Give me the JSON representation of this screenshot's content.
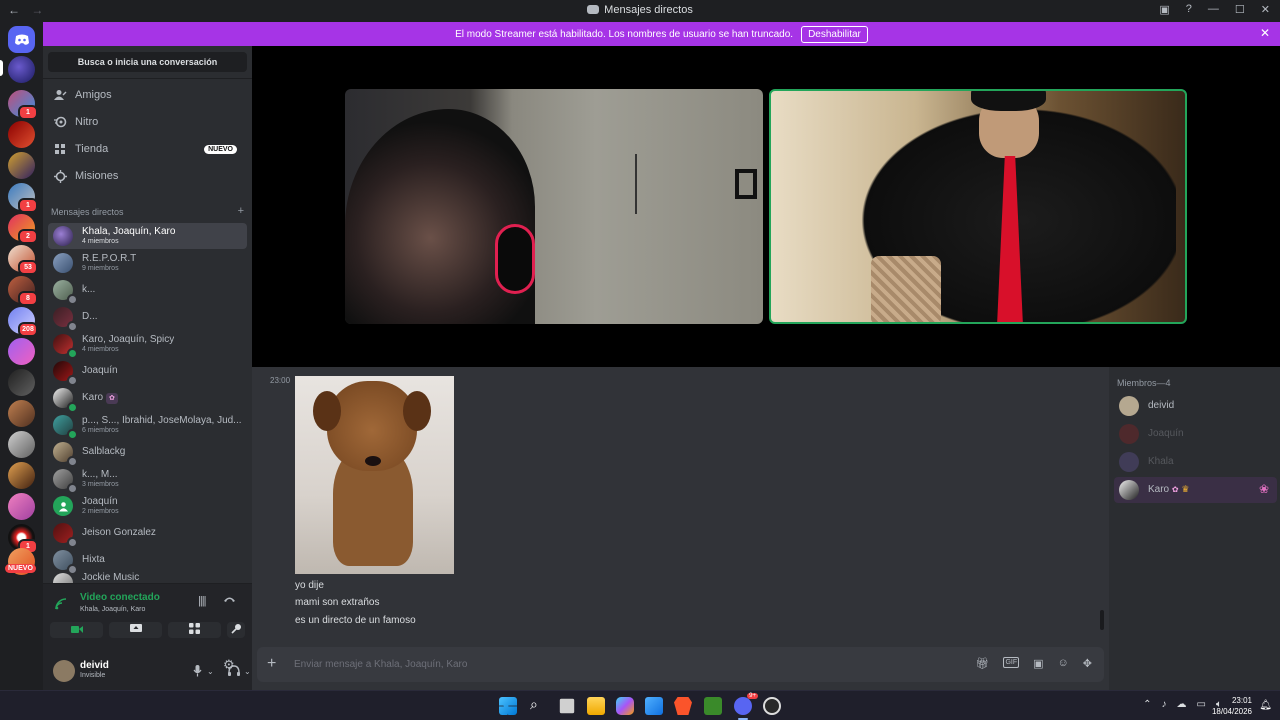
{
  "window": {
    "back": "←",
    "forward": "→",
    "title": "Mensajes directos"
  },
  "banner": {
    "text": "El modo Streamer está habilitado. Los nombres de usuario se han truncado.",
    "button": "Deshabilitar",
    "close": "✕"
  },
  "rail": {
    "badges": [
      "1",
      "2",
      "53",
      "8",
      "208",
      "1"
    ],
    "new_label": "NUEVO"
  },
  "sidebar": {
    "search_placeholder": "Busca o inicia una conversación",
    "nav": [
      {
        "label": "Amigos",
        "icon": "friends-icon"
      },
      {
        "label": "Nitro",
        "icon": "nitro-icon"
      },
      {
        "label": "Tienda",
        "icon": "shop-icon",
        "badge": "NUEVO"
      },
      {
        "label": "Misiones",
        "icon": "quests-icon"
      }
    ],
    "dm_header": "Mensajes directos",
    "dm_add": "+",
    "dms": [
      {
        "name": "Khala, Joaquín, Karo",
        "sub": "4 miembros"
      },
      {
        "name": "R.E.P.O.R.T",
        "sub": "9 miembros"
      },
      {
        "name": "k..."
      },
      {
        "name": "D..."
      },
      {
        "name": "Karo, Joaquín, Spicy",
        "sub": "4 miembros"
      },
      {
        "name": "Joaquín"
      },
      {
        "name": "Karo"
      },
      {
        "name": "p..., S..., Ibrahid, JoseMolaya, Jud...",
        "sub": "6 miembros"
      },
      {
        "name": "Salblackg"
      },
      {
        "name": "k..., M...",
        "sub": "3 miembros"
      },
      {
        "name": "Joaquín",
        "sub": "2 miembros"
      },
      {
        "name": "Jeison Gonzalez"
      },
      {
        "name": "Hixta"
      },
      {
        "name": "Jockie Music"
      }
    ]
  },
  "voice": {
    "status": "Video conectado",
    "channel": "Khala, Joaquín, Karo"
  },
  "user": {
    "name": "deivid",
    "status": "Invisible"
  },
  "chat": {
    "timestamp": "23:00",
    "messages": [
      "yo dije",
      "mami son extraños",
      "es un directo de un famoso"
    ],
    "composer_placeholder": "Enviar mensaje a Khala, Joaquín, Karo"
  },
  "members": {
    "header": "Miembros—4",
    "list": [
      "deivid",
      "Joaquín",
      "Khala",
      "Karo"
    ]
  },
  "taskbar": {
    "time": "23:01",
    "date": "18/04/2026",
    "discord_badge": "9+"
  },
  "colors": {
    "banner": "#a634e6",
    "online": "#23a55a",
    "badge": "#f23f43",
    "blurple": "#5865f2"
  }
}
